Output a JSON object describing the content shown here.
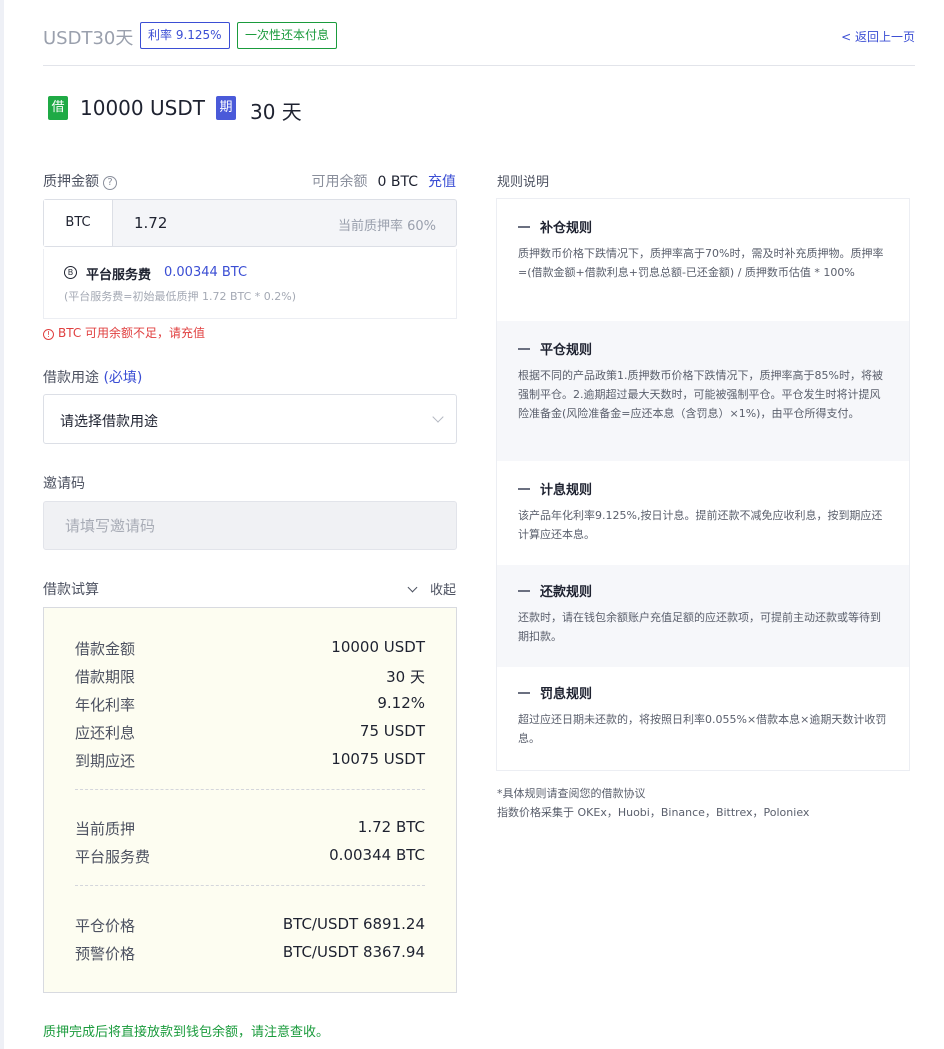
{
  "header": {
    "title": "USDT30天",
    "rate_tag": "利率 9.125%",
    "repay_tag": "一次性还本付息",
    "back_link": "< 返回上一页"
  },
  "summary": {
    "borrow_icon": "借",
    "amount": "10000 USDT",
    "term_icon": "期",
    "term": "30 天"
  },
  "collateral": {
    "label": "质押金额",
    "help_icon": "?",
    "balance_label": "可用余额",
    "balance_value": "0 BTC",
    "recharge": "充值",
    "currency": "BTC",
    "value": "1.72",
    "rate_text": "当前质押率 60%",
    "fee_icon": "coin-icon",
    "fee_label": "平台服务费",
    "fee_value": "0.00344 BTC",
    "fee_note": "(平台服务费=初始最低质押 1.72 BTC * 0.2%)",
    "error": "BTC 可用余额不足，请充值"
  },
  "purpose": {
    "label": "借款用途",
    "required": "(必填)",
    "value": "请选择借款用途"
  },
  "invite": {
    "label": "邀请码",
    "placeholder": "请填写邀请码"
  },
  "calc": {
    "label": "借款试算",
    "collapse": "收起",
    "rows": [
      {
        "k": "借款金额",
        "v": "10000 USDT"
      },
      {
        "k": "借款期限",
        "v": "30 天"
      },
      {
        "k": "年化利率",
        "v": "9.12%"
      },
      {
        "k": "应还利息",
        "v": "75 USDT"
      },
      {
        "k": "到期应还",
        "v": "10075 USDT"
      },
      {
        "k": "当前质押",
        "v": "1.72 BTC"
      },
      {
        "k": "平台服务费",
        "v": "0.00344 BTC"
      },
      {
        "k": "平仓价格",
        "v": "BTC/USDT 6891.24"
      },
      {
        "k": "预警价格",
        "v": "BTC/USDT 8367.94"
      }
    ]
  },
  "final_note": "质押完成后将直接放款到钱包余额，请注意查收。",
  "rules": {
    "title": "规则说明",
    "items": [
      {
        "h": "补仓规则",
        "t": "质押数币价格下跌情况下，质押率高于70%时，需及时补充质押物。质押率=(借款金额+借款利息+罚息总额-已还金额) / 质押数币估值 * 100%"
      },
      {
        "h": "平仓规则",
        "t": "根据不同的产品政策1.质押数币价格下跌情况下，质押率高于85%时，将被强制平仓。2.逾期超过最大天数时，可能被强制平仓。平仓发生时将计提风险准备金(风险准备金=应还本息（含罚息）×1%)，由平仓所得支付。"
      },
      {
        "h": "计息规则",
        "t": "该产品年化利率9.125%,按日计息。提前还款不减免应收利息，按到期应还计算应还本息。"
      },
      {
        "h": "还款规则",
        "t": "还款时，请在钱包余额账户充值足额的应还款项，可提前主动还款或等待到期扣款。"
      },
      {
        "h": "罚息规则",
        "t": "超过应还日期未还款的，将按照日利率0.055%×借款本息×逾期天数计收罚息。"
      }
    ],
    "footnote1": "*具体规则请查阅您的借款协议",
    "footnote2": "指数价格采集于 OKEx，Huobi，Binance，Bittrex，Poloniex"
  }
}
